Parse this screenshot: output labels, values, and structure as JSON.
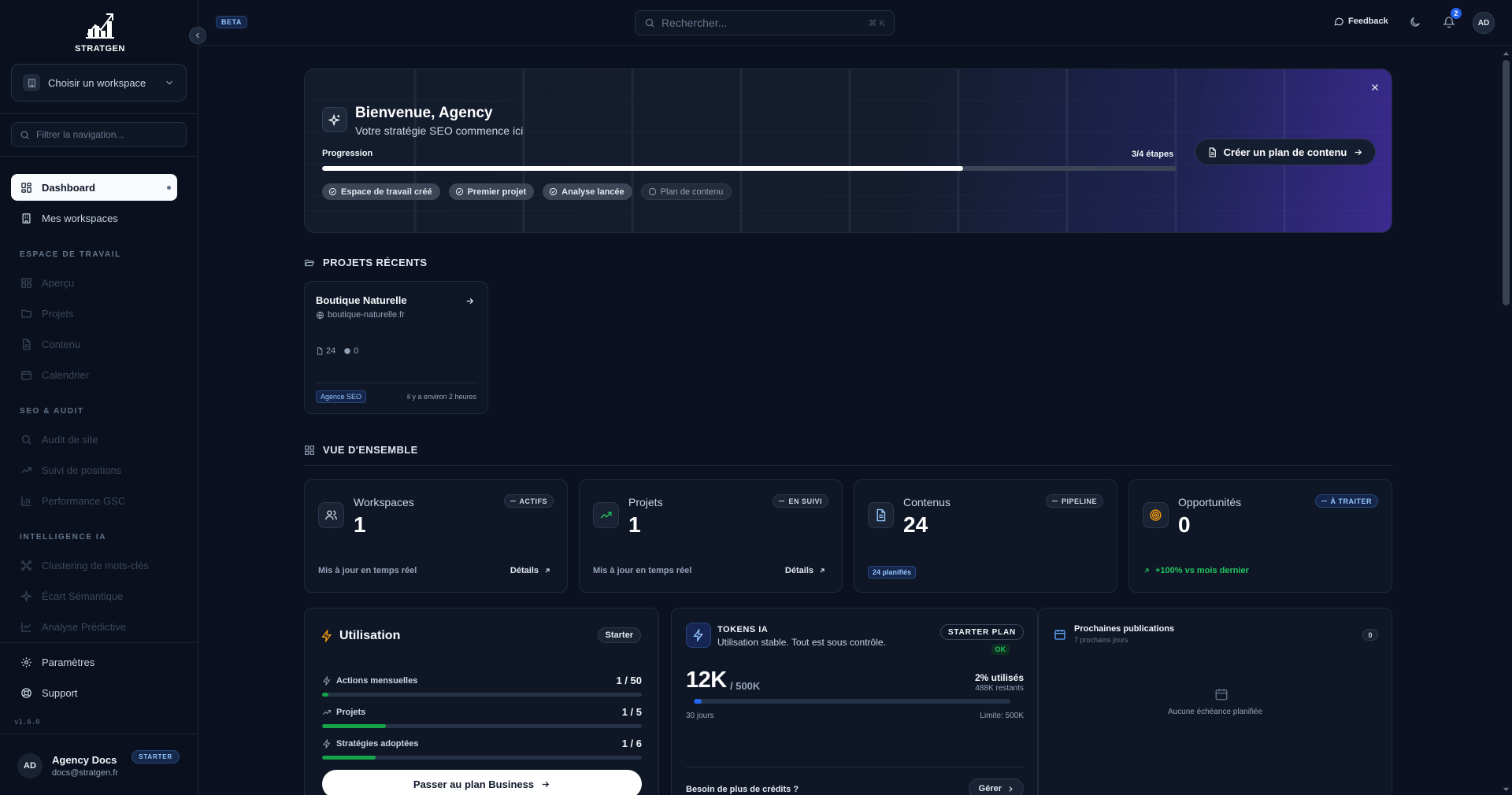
{
  "brand": {
    "name": "STRATGEN"
  },
  "sidebar": {
    "workspace_select": "Choisir un workspace",
    "filter_placeholder": "Filtrer la navigation...",
    "main": [
      {
        "label": "Dashboard",
        "icon": "dashboard-icon",
        "active": true
      },
      {
        "label": "Mes workspaces",
        "icon": "building-icon"
      }
    ],
    "sections": [
      {
        "title": "ESPACE DE TRAVAIL",
        "items": [
          {
            "label": "Aperçu",
            "icon": "grid-icon"
          },
          {
            "label": "Projets",
            "icon": "folder-icon"
          },
          {
            "label": "Contenu",
            "icon": "file-icon"
          },
          {
            "label": "Calendrier",
            "icon": "calendar-icon"
          }
        ]
      },
      {
        "title": "SEO & AUDIT",
        "items": [
          {
            "label": "Audit de site",
            "icon": "search-icon"
          },
          {
            "label": "Suivi de positions",
            "icon": "trending-icon"
          },
          {
            "label": "Performance GSC",
            "icon": "bar-chart-icon"
          }
        ]
      },
      {
        "title": "INTELLIGENCE IA",
        "items": [
          {
            "label": "Clustering de mots-clés",
            "icon": "network-icon"
          },
          {
            "label": "Écart Sémantique",
            "icon": "sparkles-icon"
          },
          {
            "label": "Analyse Prédictive",
            "icon": "line-chart-icon"
          }
        ]
      }
    ],
    "bottom": [
      {
        "label": "Paramètres",
        "icon": "gear-icon"
      },
      {
        "label": "Support",
        "icon": "lifebuoy-icon"
      }
    ],
    "version": "v1.6.0",
    "user": {
      "initials": "AD",
      "name": "Agency Docs",
      "email": "docs@stratgen.fr",
      "plan": "STARTER"
    }
  },
  "topbar": {
    "beta": "BETA",
    "search_placeholder": "Rechercher...",
    "search_shortcut": "⌘ K",
    "feedback": "Feedback",
    "notifications": "2",
    "avatar": "AD"
  },
  "hero": {
    "title": "Bienvenue, Agency",
    "subtitle": "Votre stratégie SEO commence ici",
    "progress_label": "Progression",
    "progress_steps": "3/4 étapes",
    "progress_fraction": 0.75,
    "cta": "Créer un plan de contenu",
    "chips": [
      {
        "label": "Espace de travail créé",
        "done": true
      },
      {
        "label": "Premier projet",
        "done": true
      },
      {
        "label": "Analyse lancée",
        "done": true
      },
      {
        "label": "Plan de contenu",
        "done": false
      }
    ]
  },
  "recent": {
    "title": "PROJETS RÉCENTS",
    "project": {
      "name": "Boutique Naturelle",
      "url": "boutique-naturelle.fr",
      "contents": "24",
      "opportunities": "0",
      "tag": "Agence SEO",
      "time": "il y a environ 2 heures"
    }
  },
  "overview": {
    "title": "VUE D'ENSEMBLE",
    "stats": [
      {
        "label": "Workspaces",
        "value": "1",
        "badge": "ACTIFS",
        "foot": "Mis à jour en temps réel",
        "link": "Détails"
      },
      {
        "label": "Projets",
        "value": "1",
        "badge": "EN SUIVI",
        "foot": "Mis à jour en temps réel",
        "link": "Détails"
      },
      {
        "label": "Contenus",
        "value": "24",
        "badge": "PIPELINE",
        "pill": "24 planifiés"
      },
      {
        "label": "Opportunités",
        "value": "0",
        "badge": "À TRAITER",
        "trend": "+100% vs mois dernier"
      }
    ]
  },
  "usage": {
    "title": "Utilisation",
    "plan": "Starter",
    "rows": [
      {
        "label": "Actions mensuelles",
        "value": "1 / 50",
        "fraction": 0.02
      },
      {
        "label": "Projets",
        "value": "1 / 5",
        "fraction": 0.2
      },
      {
        "label": "Stratégies adoptées",
        "value": "1 / 6",
        "fraction": 0.167
      }
    ],
    "upgrade": "Passer au plan Business"
  },
  "tokens": {
    "title": "TOKENS IA",
    "subtitle": "Utilisation stable. Tout est sous contrôle.",
    "plan": "STARTER PLAN",
    "status": "OK",
    "used": "12K",
    "total": "/ 500K",
    "percent": "2% utilisés",
    "remaining": "488K restants",
    "fraction": 0.024,
    "period": "30 jours",
    "limit": "Limite: 500K",
    "need_more": "Besoin de plus de crédits ?",
    "manage": "Gérer"
  },
  "publications": {
    "title": "Prochaines publications",
    "subtitle": "7 prochains jours",
    "count": "0",
    "empty": "Aucune échéance planifiée"
  },
  "colors": {
    "background": "#0b1120",
    "accent": "#2563eb",
    "success": "#22c55e",
    "warning": "#f59e0b",
    "hero_gradient_end": "#3b2a8f"
  }
}
